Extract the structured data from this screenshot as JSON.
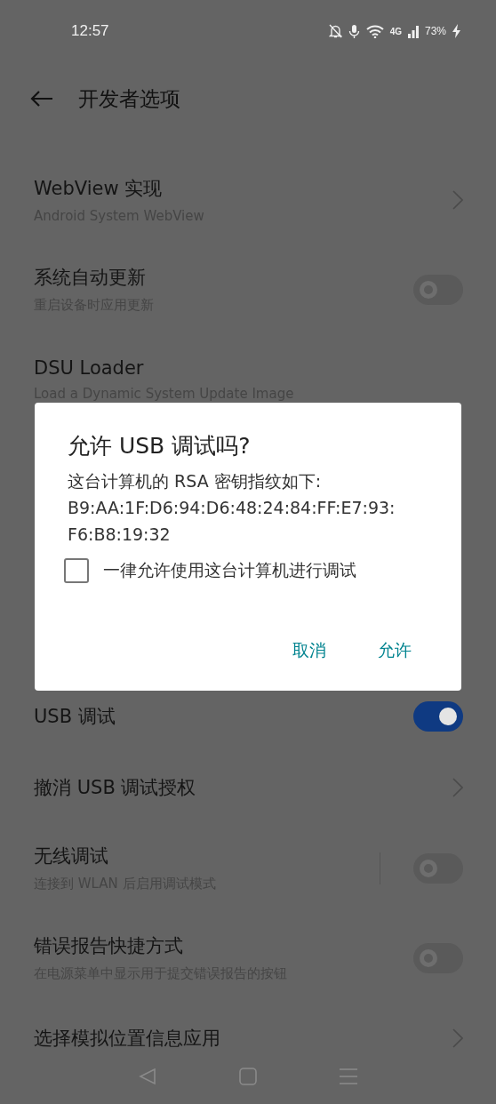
{
  "status_bar": {
    "time": "12:57",
    "network": "4G",
    "battery": "73%"
  },
  "header": {
    "title": "开发者选项"
  },
  "settings_above": [
    {
      "kind": "link",
      "title": "WebView 实现",
      "subtitle": "Android System WebView"
    },
    {
      "kind": "toggle",
      "title": "系统自动更新",
      "subtitle": "重启设备时应用更新",
      "on": false
    },
    {
      "kind": "plain",
      "title": "DSU Loader",
      "subtitle": "Load a Dynamic System Update Image"
    }
  ],
  "settings_below": [
    {
      "kind": "toggle",
      "title": "USB 调试",
      "on": true
    },
    {
      "kind": "link",
      "title": "撤消 USB 调试授权"
    },
    {
      "kind": "split_toggle",
      "title": "无线调试",
      "subtitle": "连接到 WLAN 后启用调试模式",
      "on": false
    },
    {
      "kind": "toggle",
      "title": "错误报告快捷方式",
      "subtitle": "在电源菜单中显示用于提交错误报告的按钮",
      "on": false
    },
    {
      "kind": "link",
      "title": "选择模拟位置信息应用"
    }
  ],
  "dialog": {
    "title": "允许 USB 调试吗?",
    "message": "这台计算机的 RSA 密钥指纹如下:",
    "fingerprint": "B9:AA:1F:D6:94:D6:48:24:84:FF:E7:93:F6:B8:19:32",
    "checkbox": {
      "label": "一律允许使用这台计算机进行调试",
      "checked": false
    },
    "buttons": [
      "取消",
      "允许"
    ]
  }
}
